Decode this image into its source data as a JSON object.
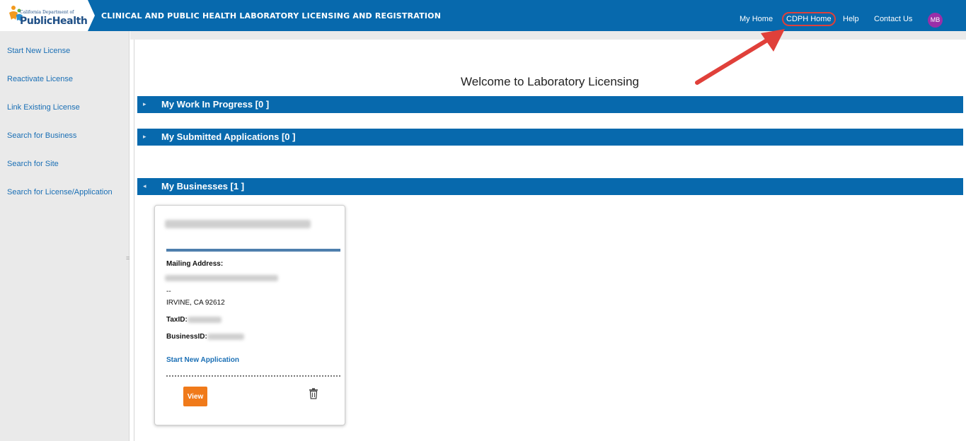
{
  "header": {
    "logo": {
      "line1": "California Department of",
      "line2": "PublicHealth"
    },
    "title": "CLINICAL AND PUBLIC HEALTH LABORATORY LICENSING AND REGISTRATION",
    "nav": {
      "my_home": "My Home",
      "cdph_home": "CDPH Home",
      "help": "Help",
      "contact_us": "Contact Us"
    },
    "avatar_initials": "MB",
    "highlight_color": "#e0403a"
  },
  "sidebar": {
    "items": [
      {
        "label": "Start New License"
      },
      {
        "label": "Reactivate License"
      },
      {
        "label": "Link Existing License"
      },
      {
        "label": "Search for Business"
      },
      {
        "label": "Search for Site"
      },
      {
        "label": "Search for License/Application"
      }
    ],
    "grip": "="
  },
  "main": {
    "welcome": "Welcome to Laboratory Licensing",
    "sections": [
      {
        "label": "My Work In Progress [0 ]",
        "expanded": false,
        "icon": "triangle-right-icon"
      },
      {
        "label": "My Submitted Applications [0 ]",
        "expanded": false,
        "icon": "triangle-right-icon"
      },
      {
        "label": "My Businesses [1 ]",
        "expanded": true,
        "icon": "triangle-left-icon"
      }
    ],
    "business_card": {
      "mailing_address_label": "Mailing Address:",
      "address_line2": "--",
      "city_line": "IRVINE, CA 92612",
      "taxid_label": "TaxID:",
      "businessid_label": "BusinessID:",
      "start_new_application": "Start New Application",
      "view_button": "View",
      "delete_icon": "trash-icon"
    }
  },
  "colors": {
    "header_blue": "#0769ad",
    "link_blue": "#1a6fb5",
    "view_orange": "#f07a1a",
    "avatar_purple": "#9b2fa8",
    "sidebar_gray": "#eaeaea"
  }
}
